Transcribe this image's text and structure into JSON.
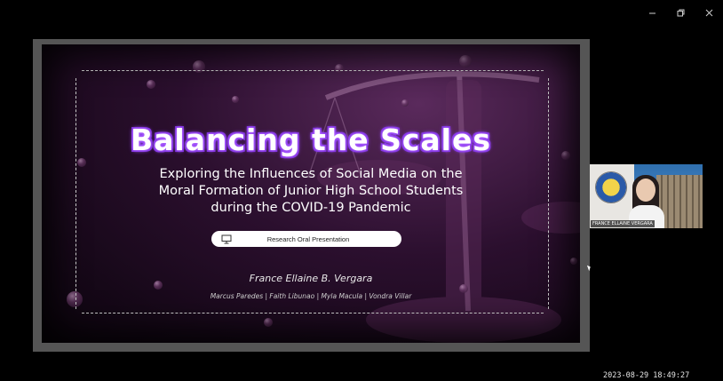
{
  "window": {
    "minimize_icon": "minimize-icon",
    "restore_icon": "restore-icon",
    "close_icon": "close-icon"
  },
  "slide": {
    "title": "Balancing the Scales",
    "subtitle_lines": [
      "Exploring the Influences of Social Media on the",
      "Moral Formation of Junior High School Students",
      "during the COVID-19 Pandemic"
    ],
    "pill_label": "Research Oral Presentation",
    "pill_icon": "presentation-icon",
    "presenter": "France Ellaine B. Vergara",
    "members": "Marcus Paredes | Faith Libunao | Myla Macula | Vondra Villar"
  },
  "video": {
    "name_tag": "FRANCE ELLAINE VERGARA"
  },
  "status": {
    "timestamp": "2023-08-29 18:49:27"
  },
  "colors": {
    "title_glow": "#7b2fd6",
    "slide_bg": "#2b0f2e"
  }
}
